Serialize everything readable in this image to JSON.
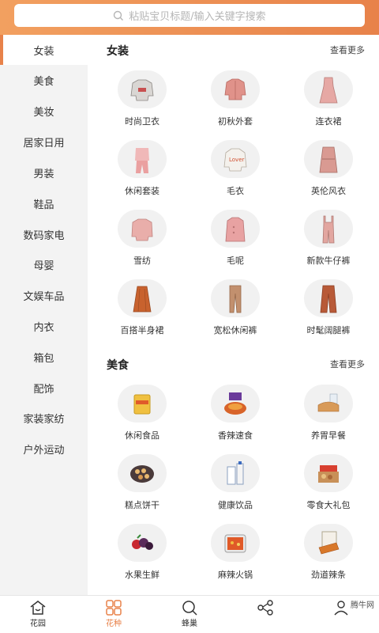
{
  "search": {
    "placeholder": "粘贴宝贝标题/输入关键字搜索"
  },
  "sidebar": {
    "items": [
      {
        "label": "女装"
      },
      {
        "label": "美食"
      },
      {
        "label": "美妆"
      },
      {
        "label": "居家日用"
      },
      {
        "label": "男装"
      },
      {
        "label": "鞋品"
      },
      {
        "label": "数码家电"
      },
      {
        "label": "母婴"
      },
      {
        "label": "文娱车品"
      },
      {
        "label": "内衣"
      },
      {
        "label": "箱包"
      },
      {
        "label": "配饰"
      },
      {
        "label": "家装家纺"
      },
      {
        "label": "户外运动"
      }
    ]
  },
  "sections": [
    {
      "title": "女装",
      "more": "查看更多",
      "items": [
        {
          "label": "时尚卫衣",
          "icon": "sweatshirt-icon"
        },
        {
          "label": "初秋外套",
          "icon": "jacket-icon"
        },
        {
          "label": "连衣裙",
          "icon": "dress-icon"
        },
        {
          "label": "休闲套装",
          "icon": "casual-set-icon"
        },
        {
          "label": "毛衣",
          "icon": "sweater-icon"
        },
        {
          "label": "英伦风衣",
          "icon": "trench-coat-icon"
        },
        {
          "label": "雪纺",
          "icon": "chiffon-top-icon"
        },
        {
          "label": "毛呢",
          "icon": "wool-coat-icon"
        },
        {
          "label": "新款牛仔裤",
          "icon": "overalls-icon"
        },
        {
          "label": "百搭半身裙",
          "icon": "skirt-icon"
        },
        {
          "label": "宽松休闲裤",
          "icon": "trousers-icon"
        },
        {
          "label": "时髦阔腿裤",
          "icon": "wide-pants-icon"
        }
      ]
    },
    {
      "title": "美食",
      "more": "查看更多",
      "items": [
        {
          "label": "休闲食品",
          "icon": "snack-bag-icon"
        },
        {
          "label": "香辣速食",
          "icon": "spicy-food-icon"
        },
        {
          "label": "养胃早餐",
          "icon": "bread-icon"
        },
        {
          "label": "糕点饼干",
          "icon": "cookies-icon"
        },
        {
          "label": "健康饮品",
          "icon": "drink-bottle-icon"
        },
        {
          "label": "零食大礼包",
          "icon": "gift-box-icon"
        },
        {
          "label": "水果生鲜",
          "icon": "fruit-icon"
        },
        {
          "label": "麻辣火锅",
          "icon": "hotpot-icon"
        },
        {
          "label": "劲道辣条",
          "icon": "spicy-strips-icon"
        }
      ]
    }
  ],
  "tabbar": {
    "items": [
      {
        "label": "花园",
        "icon": "home-icon"
      },
      {
        "label": "花种",
        "icon": "grid-icon"
      },
      {
        "label": "蜂巢",
        "icon": "search-icon"
      },
      {
        "label": "",
        "icon": "share-icon"
      },
      {
        "label": "",
        "icon": "user-icon"
      }
    ]
  },
  "watermark": {
    "text": "腾牛网"
  },
  "colors": {
    "accent": "#e8824a",
    "header_start": "#f2a060",
    "header_end": "#e8824a",
    "sidebar_bg": "#f3f3f3"
  }
}
